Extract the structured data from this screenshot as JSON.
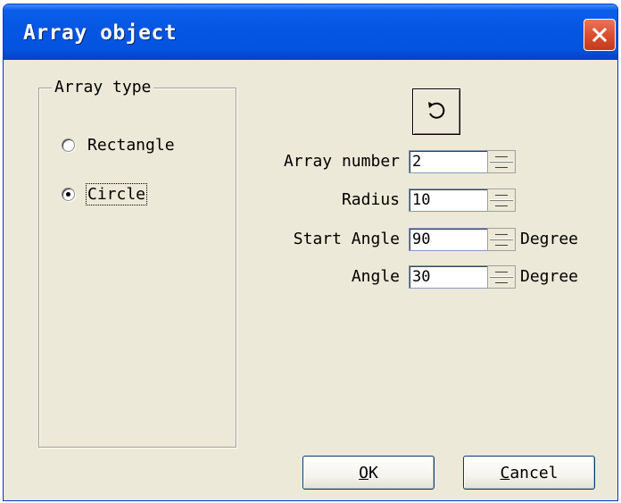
{
  "window": {
    "title": "Array object",
    "close_icon": "close-icon"
  },
  "array_type": {
    "label": "Array type",
    "options": [
      {
        "label": "Rectangle",
        "checked": false
      },
      {
        "label": "Circle",
        "checked": true
      }
    ]
  },
  "toolbar": {
    "rotate_icon": "rotate-direction-icon"
  },
  "fields": [
    {
      "label": "Array number",
      "value": "2",
      "unit": ""
    },
    {
      "label": "Radius",
      "value": "10",
      "unit": ""
    },
    {
      "label": "Start Angle",
      "value": "90",
      "unit": "Degree"
    },
    {
      "label": "Angle",
      "value": "30",
      "unit": "Degree"
    }
  ],
  "buttons": {
    "ok_hotkey": "O",
    "ok_rest": "K",
    "cancel_hotkey": "C",
    "cancel_rest": "ancel"
  }
}
